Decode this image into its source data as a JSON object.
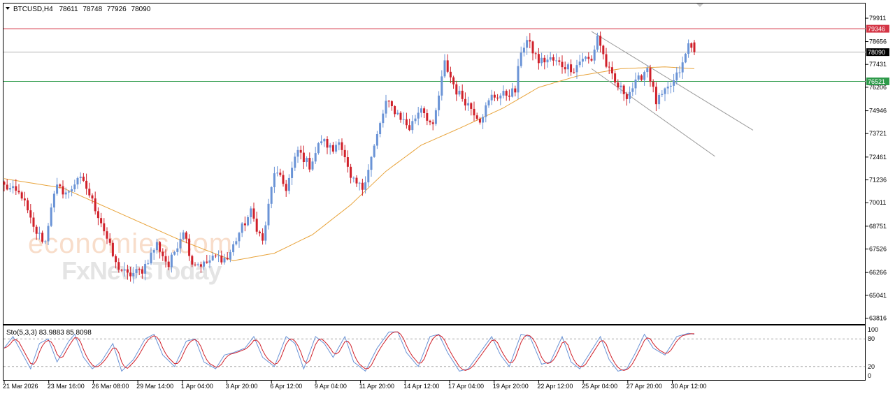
{
  "header": {
    "symbol": "BTCUSD,H4",
    "open": "78611",
    "high": "78748",
    "low": "77926",
    "close": "78090"
  },
  "watermark": {
    "line1": "economies.com",
    "line2": "FxNewsToday"
  },
  "colors": {
    "bull": "#6a93d6",
    "bear": "#d0202a",
    "ma": "#e8a33a",
    "resistance": "#d43545",
    "support": "#2e9a4a",
    "price_line": "#b0b0b0",
    "channel": "#9c9c9c",
    "stoch_main": "#6a93d6",
    "stoch_signal": "#d0202a"
  },
  "price_axis": {
    "ticks": [
      "79911",
      "78656",
      "77431",
      "76206",
      "74946",
      "73721",
      "72461",
      "71236",
      "70011",
      "68751",
      "67526",
      "66266",
      "65041",
      "63816"
    ],
    "resistance": "79346",
    "current": "78090",
    "support": "76521"
  },
  "time_axis": [
    "21 Mar 2026",
    "23 Mar 16:00",
    "26 Mar 08:00",
    "29 Mar 14:00",
    "1 Apr 04:00",
    "3 Apr 20:00",
    "6 Apr 12:00",
    "9 Apr 04:00",
    "11 Apr 20:00",
    "14 Apr 12:00",
    "17 Apr 04:00",
    "19 Apr 20:00",
    "22 Apr 12:00",
    "25 Apr 04:00",
    "27 Apr 20:00",
    "30 Apr 12:00"
  ],
  "stoch": {
    "label": "Sto(5,3,3) 83.9883 85.8098",
    "levels": [
      "100",
      "80",
      "20",
      "0"
    ]
  },
  "chart_data": {
    "type": "candlestick",
    "title": "BTCUSD,H4 78611 78748 77926 78090",
    "ylim": [
      63500,
      80700
    ],
    "levels": {
      "resistance": 79346,
      "support": 76521,
      "last": 78090
    },
    "anchors": [
      [
        0,
        70900
      ],
      [
        6,
        70400
      ],
      [
        10,
        68600
      ],
      [
        14,
        67900
      ],
      [
        16,
        69900
      ],
      [
        18,
        70800
      ],
      [
        22,
        70500
      ],
      [
        25,
        71400
      ],
      [
        28,
        70800
      ],
      [
        33,
        69000
      ],
      [
        38,
        66700
      ],
      [
        42,
        66100
      ],
      [
        47,
        66400
      ],
      [
        52,
        67800
      ],
      [
        56,
        66600
      ],
      [
        61,
        68600
      ],
      [
        64,
        66800
      ],
      [
        68,
        66700
      ],
      [
        72,
        67100
      ],
      [
        76,
        67000
      ],
      [
        80,
        68400
      ],
      [
        84,
        69500
      ],
      [
        88,
        67900
      ],
      [
        92,
        71700
      ],
      [
        96,
        70800
      ],
      [
        100,
        72800
      ],
      [
        104,
        72000
      ],
      [
        108,
        73400
      ],
      [
        112,
        72800
      ],
      [
        114,
        73500
      ],
      [
        118,
        71200
      ],
      [
        122,
        70800
      ],
      [
        126,
        73000
      ],
      [
        130,
        75400
      ],
      [
        134,
        74800
      ],
      [
        138,
        74000
      ],
      [
        142,
        75200
      ],
      [
        146,
        74000
      ],
      [
        150,
        77500
      ],
      [
        154,
        76000
      ],
      [
        158,
        75300
      ],
      [
        162,
        74500
      ],
      [
        166,
        75700
      ],
      [
        170,
        75800
      ],
      [
        174,
        76000
      ],
      [
        176,
        78200
      ],
      [
        178,
        78700
      ],
      [
        182,
        77600
      ],
      [
        186,
        77700
      ],
      [
        190,
        77400
      ],
      [
        194,
        77200
      ],
      [
        197,
        77800
      ],
      [
        200,
        77600
      ],
      [
        202,
        79000
      ],
      [
        205,
        77400
      ],
      [
        208,
        76400
      ],
      [
        212,
        75800
      ],
      [
        216,
        76600
      ],
      [
        219,
        77300
      ],
      [
        222,
        75400
      ],
      [
        225,
        75900
      ],
      [
        228,
        76500
      ],
      [
        231,
        77400
      ],
      [
        233,
        78500
      ],
      [
        235,
        78090
      ]
    ],
    "ma_anchors": [
      [
        0,
        71300
      ],
      [
        20,
        70800
      ],
      [
        40,
        69400
      ],
      [
        60,
        68000
      ],
      [
        78,
        66900
      ],
      [
        92,
        67300
      ],
      [
        105,
        68300
      ],
      [
        118,
        69900
      ],
      [
        130,
        71700
      ],
      [
        142,
        73100
      ],
      [
        155,
        74000
      ],
      [
        170,
        75100
      ],
      [
        182,
        76200
      ],
      [
        195,
        76800
      ],
      [
        210,
        77200
      ],
      [
        225,
        77300
      ],
      [
        235,
        77200
      ]
    ],
    "stoch_ylim": [
      0,
      100
    ],
    "stoch_levels": [
      20,
      80
    ],
    "stoch_last": {
      "main": 83.9883,
      "signal": 85.8098
    },
    "stoch_anchors": [
      [
        0,
        60
      ],
      [
        3,
        85
      ],
      [
        6,
        50
      ],
      [
        9,
        15
      ],
      [
        12,
        70
      ],
      [
        15,
        80
      ],
      [
        18,
        30
      ],
      [
        22,
        75
      ],
      [
        24,
        90
      ],
      [
        27,
        40
      ],
      [
        30,
        15
      ],
      [
        33,
        30
      ],
      [
        37,
        70
      ],
      [
        40,
        10
      ],
      [
        44,
        35
      ],
      [
        48,
        80
      ],
      [
        51,
        90
      ],
      [
        54,
        45
      ],
      [
        58,
        20
      ],
      [
        62,
        75
      ],
      [
        65,
        80
      ],
      [
        68,
        30
      ],
      [
        72,
        15
      ],
      [
        75,
        45
      ],
      [
        78,
        50
      ],
      [
        82,
        60
      ],
      [
        85,
        85
      ],
      [
        88,
        40
      ],
      [
        92,
        20
      ],
      [
        96,
        85
      ],
      [
        99,
        70
      ],
      [
        102,
        15
      ],
      [
        106,
        85
      ],
      [
        109,
        70
      ],
      [
        112,
        40
      ],
      [
        116,
        85
      ],
      [
        119,
        30
      ],
      [
        123,
        10
      ],
      [
        127,
        60
      ],
      [
        131,
        95
      ],
      [
        134,
        95
      ],
      [
        137,
        50
      ],
      [
        141,
        20
      ],
      [
        145,
        85
      ],
      [
        148,
        90
      ],
      [
        151,
        50
      ],
      [
        155,
        10
      ],
      [
        158,
        15
      ],
      [
        162,
        50
      ],
      [
        166,
        85
      ],
      [
        169,
        45
      ],
      [
        172,
        20
      ],
      [
        176,
        90
      ],
      [
        179,
        85
      ],
      [
        183,
        25
      ],
      [
        186,
        30
      ],
      [
        190,
        85
      ],
      [
        193,
        30
      ],
      [
        196,
        15
      ],
      [
        199,
        45
      ],
      [
        203,
        85
      ],
      [
        206,
        35
      ],
      [
        209,
        10
      ],
      [
        212,
        15
      ],
      [
        215,
        50
      ],
      [
        218,
        90
      ],
      [
        221,
        60
      ],
      [
        225,
        45
      ],
      [
        229,
        85
      ],
      [
        233,
        92
      ],
      [
        235,
        90
      ]
    ]
  }
}
